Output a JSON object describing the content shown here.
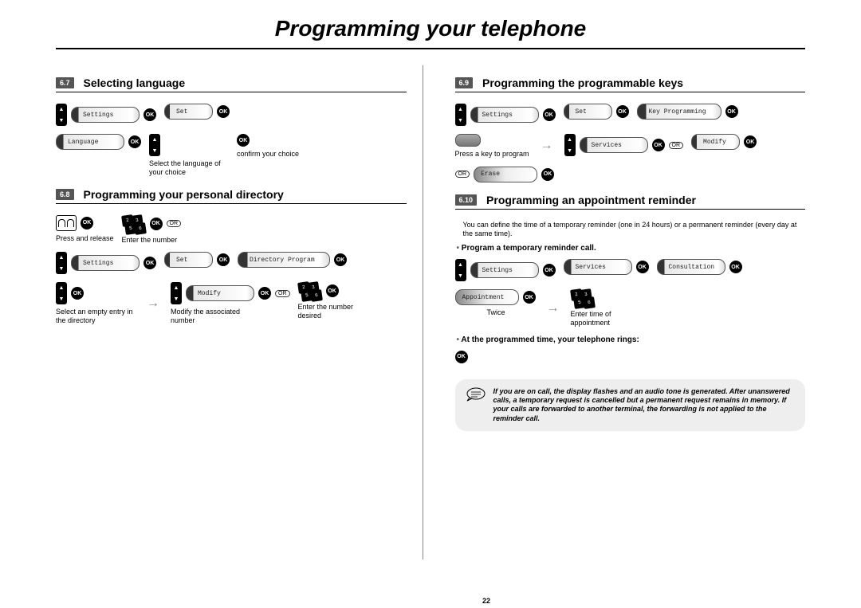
{
  "title": "Programming your telephone",
  "page_number": "22",
  "labels": {
    "ok": "OK",
    "or": "OR"
  },
  "pills": {
    "settings": "Settings",
    "set": "Set",
    "language": "Language",
    "directory_program": "Directory Program",
    "modify": "Modify",
    "key_programming": "Key Programming",
    "services": "Services",
    "erase": "Erase",
    "consultation": "Consultation",
    "appointment": "Appointment"
  },
  "sections": {
    "s67": {
      "num": "6.7",
      "title": "Selecting language"
    },
    "s68": {
      "num": "6.8",
      "title": "Programming your personal directory"
    },
    "s69": {
      "num": "6.9",
      "title": "Programming the programmable keys"
    },
    "s610": {
      "num": "6.10",
      "title": "Programming an appointment reminder"
    }
  },
  "captions": {
    "select_lang": "Select the language of your choice",
    "confirm": "confirm your choice",
    "press_release": "Press and release",
    "enter_number": "Enter the number",
    "select_empty": "Select an empty entry in the directory",
    "modify_assoc": "Modify the associated number",
    "enter_number_desired": "Enter the number desired",
    "press_key": "Press a key to program",
    "twice": "Twice",
    "enter_time": "Enter time of appointment"
  },
  "text": {
    "reminder_intro": "You can define the time of a temporary reminder (one in 24 hours) or a permanent reminder (every day at the same time).",
    "program_temp": "Program a temporary reminder call.",
    "at_programmed": "At the programmed time, your telephone rings:",
    "note": "If you are on call, the display flashes and an audio tone is generated. After unanswered calls, a temporary request is cancelled but a permanent request remains in memory. If your calls are forwarded to another terminal, the forwarding is not applied to the reminder call."
  }
}
